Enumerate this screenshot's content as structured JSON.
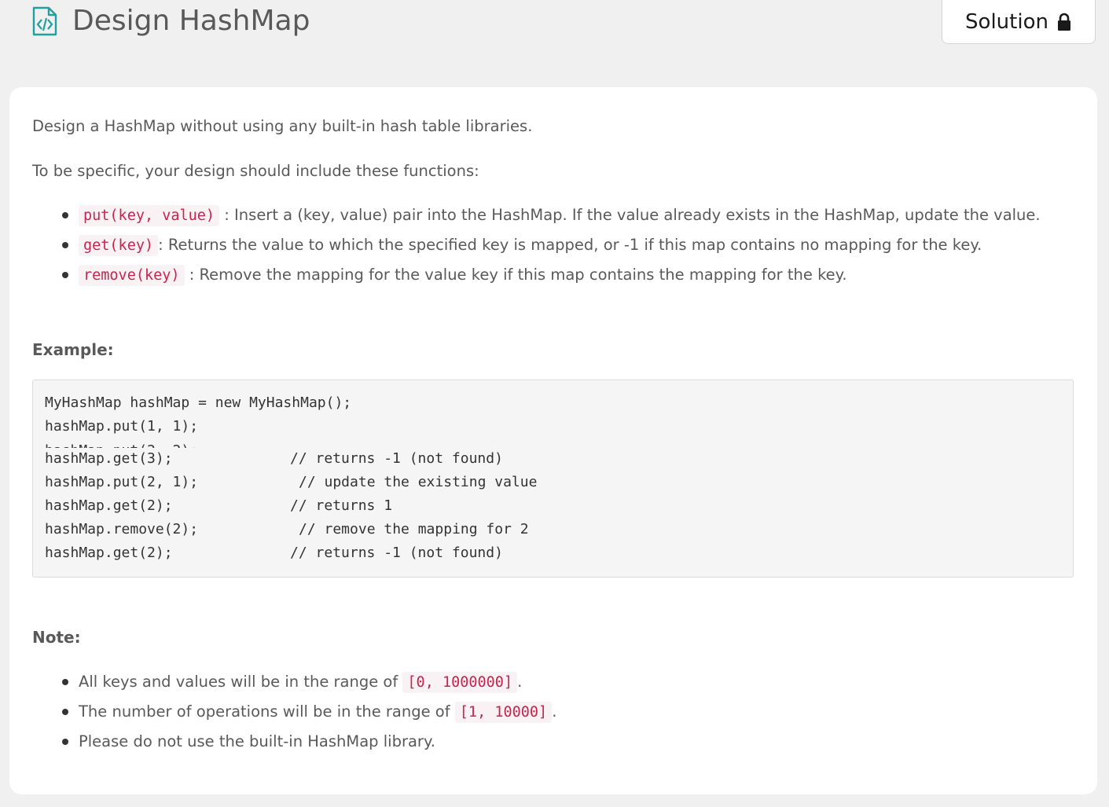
{
  "header": {
    "title": "Design HashMap",
    "solution_label": "Solution",
    "icons": {
      "title_icon": "code-file-icon",
      "solution_icon": "lock-icon"
    },
    "accent_color": "#20a0a0"
  },
  "description": {
    "intro": "Design a HashMap without using any built-in hash table libraries.",
    "specific": "To be specific, your design should include these functions:",
    "functions": [
      {
        "code": "put(key, value)",
        "text": " : Insert a (key, value) pair into the HashMap. If the value already exists in the HashMap, update the value."
      },
      {
        "code": "get(key)",
        "text": ": Returns the value to which the specified key is mapped, or -1 if this map contains no mapping for the key."
      },
      {
        "code": "remove(key)",
        "text": " : Remove the mapping for the value key if this map contains the mapping for the key."
      }
    ]
  },
  "example": {
    "heading": "Example:",
    "lines": [
      "MyHashMap hashMap = new MyHashMap();",
      "hashMap.put(1, 1);",
      "hashMap.put(2, 2);",
      "hashMap.get(3);",
      "hashMap.put(2, 1);",
      "hashMap.get(2);",
      "hashMap.remove(2);",
      "hashMap.get(2);"
    ],
    "comments": [
      "// returns -1 (not found)",
      "// update the existing value",
      "// returns 1",
      "// remove the mapping for 2",
      "// returns -1 (not found)"
    ]
  },
  "note": {
    "heading": "Note:",
    "items": [
      {
        "pre": "All keys and values will be in the range of ",
        "code": "[0, 1000000]",
        "post": "."
      },
      {
        "pre": "The number of operations will be in the range of ",
        "code": "[1, 10000]",
        "post": "."
      },
      {
        "pre": "Please do not use the built-in HashMap library.",
        "code": "",
        "post": ""
      }
    ]
  }
}
